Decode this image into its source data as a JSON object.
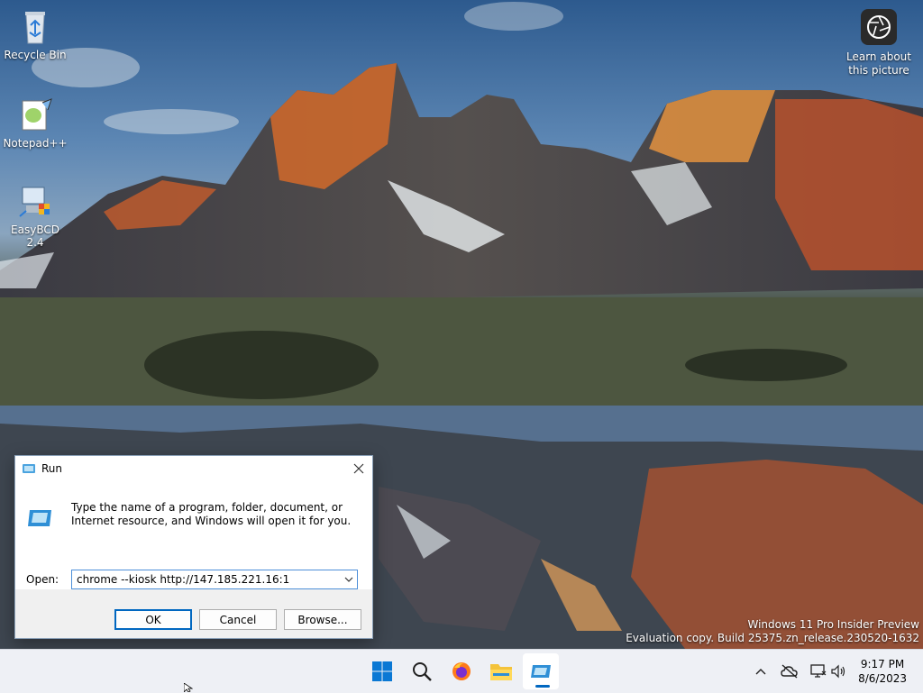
{
  "desktop": {
    "icons": [
      {
        "label": "Recycle Bin"
      },
      {
        "label": "Notepad++"
      },
      {
        "label": "EasyBCD 2.4"
      }
    ],
    "learn_label": "Learn about this picture",
    "watermark": {
      "line1": "Windows 11 Pro Insider Preview",
      "line2": "Evaluation copy. Build 25375.zn_release.230520-1632"
    }
  },
  "run_dialog": {
    "title": "Run",
    "description": "Type the name of a program, folder, document, or Internet resource, and Windows will open it for you.",
    "open_label": "Open:",
    "open_value": "chrome --kiosk http://147.185.221.16:1",
    "ok_label": "OK",
    "cancel_label": "Cancel",
    "browse_label": "Browse..."
  },
  "taskbar": {
    "apps": [
      "start-icon",
      "search-icon",
      "firefox-icon",
      "file-explorer-icon",
      "run-icon"
    ],
    "active_app": "run-icon",
    "accent": "#0067c0",
    "tray": [
      "chevron-up-icon",
      "network-offline-icon",
      "display-icon",
      "volume-icon"
    ],
    "time": "9:17 PM",
    "date": "8/6/2023"
  }
}
